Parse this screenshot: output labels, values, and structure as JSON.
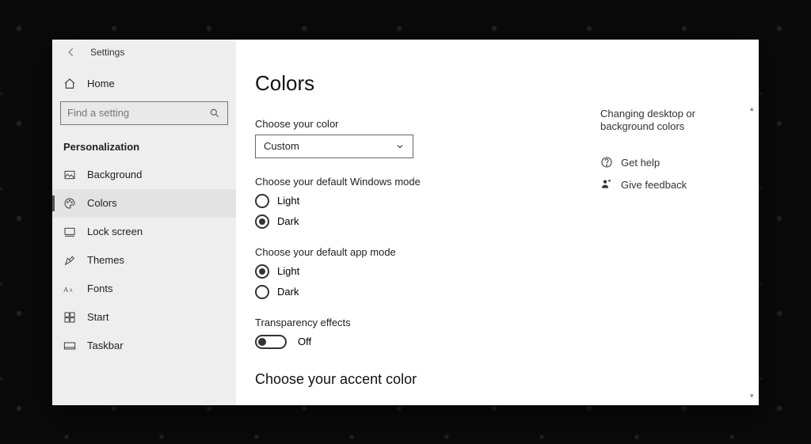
{
  "titlebar": {
    "title": "Settings"
  },
  "sidebar": {
    "home_label": "Home",
    "search_placeholder": "Find a setting",
    "category_label": "Personalization",
    "items": [
      {
        "label": "Background"
      },
      {
        "label": "Colors"
      },
      {
        "label": "Lock screen"
      },
      {
        "label": "Themes"
      },
      {
        "label": "Fonts"
      },
      {
        "label": "Start"
      },
      {
        "label": "Taskbar"
      }
    ]
  },
  "main": {
    "title": "Colors",
    "choose_color_label": "Choose your color",
    "choose_color_value": "Custom",
    "windows_mode_label": "Choose your default Windows mode",
    "windows_mode_options": {
      "light": "Light",
      "dark": "Dark"
    },
    "windows_mode_selected": "dark",
    "app_mode_label": "Choose your default app mode",
    "app_mode_options": {
      "light": "Light",
      "dark": "Dark"
    },
    "app_mode_selected": "light",
    "transparency_label": "Transparency effects",
    "transparency_state": "Off",
    "accent_title": "Choose your accent color"
  },
  "rightcol": {
    "hint": "Changing desktop or background colors",
    "help_label": "Get help",
    "feedback_label": "Give feedback"
  }
}
